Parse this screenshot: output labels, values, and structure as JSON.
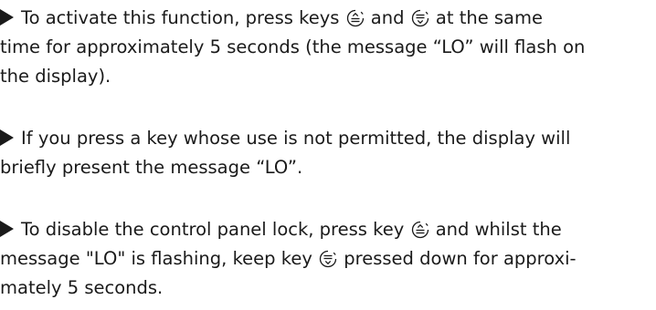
{
  "paragraphs": [
    {
      "lines": [
        {
          "a": "To activate this function, press keys ",
          "b": " and ",
          "c": " at the same"
        },
        {
          "a": "time for approximately 5 seconds (the message “LO” will flash on"
        },
        {
          "a": "the display)."
        }
      ]
    },
    {
      "lines": [
        {
          "a": "If you press a key whose use is not permitted, the display will"
        },
        {
          "a": "briefly present the message “LO”."
        }
      ]
    },
    {
      "lines": [
        {
          "a": "To disable the control panel lock, press key ",
          "b": " and whilst the"
        },
        {
          "a": "message \"LO\" is flashing, keep key ",
          "b": " pressed down for approxi-"
        },
        {
          "a": "mately 5 seconds."
        }
      ]
    }
  ],
  "icons": {
    "bullet": "right-triangle-arrow",
    "key_up": "temperature-up-key-icon",
    "key_down": "temperature-down-key-icon"
  },
  "colors": {
    "text": "#1a1a1a",
    "background": "#ffffff"
  }
}
